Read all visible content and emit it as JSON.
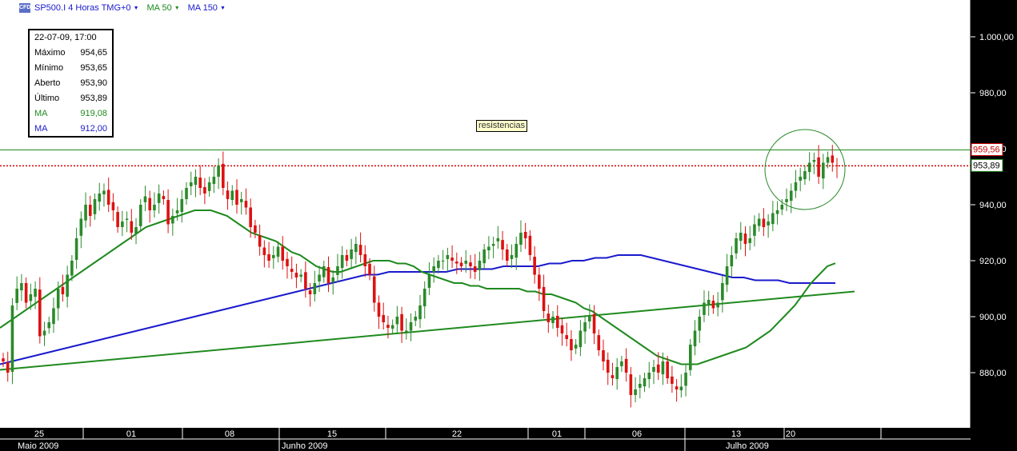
{
  "header": {
    "badge": "CFD",
    "instrument": "SP500.I 4 Horas TMG+0",
    "ma50": "MA 50",
    "ma150": "MA 150"
  },
  "colors": {
    "up": "#2a8a2a",
    "down": "#dd1111",
    "ma50": "#1f8a1f",
    "ma150": "#1a1acc",
    "trend": "#1f8a1f",
    "resistance_line": "#1f8a1f",
    "last_price_line": "#cc0000"
  },
  "info_box": {
    "datetime": "22-07-09, 17:00",
    "rows": [
      {
        "label": "Máximo",
        "value": "954,65"
      },
      {
        "label": "Mínimo",
        "value": "953,65"
      },
      {
        "label": "Aberto",
        "value": "953,90"
      },
      {
        "label": "Último",
        "value": "953,89"
      },
      {
        "label": "MA",
        "value": "919,08"
      },
      {
        "label": "MA",
        "value": "912,00"
      }
    ]
  },
  "annotation": "resistencias",
  "chart_data": {
    "type": "candlestick",
    "ylim": [
      863,
      1012
    ],
    "y_ticks": [
      "1.000,00",
      "980,00",
      "960,00",
      "940,00",
      "920,00",
      "900,00",
      "880,00"
    ],
    "y_tick_values": [
      1000,
      980,
      960,
      940,
      920,
      900,
      880
    ],
    "x_day_labels": [
      "25",
      "01",
      "08",
      "15",
      "22",
      "01",
      "06",
      "13",
      "20"
    ],
    "x_month_labels": [
      "Maio 2009",
      "Junho 2009",
      "Julho 2009"
    ],
    "resistance_level": "959,56",
    "resistance_value": 959.56,
    "last_price": "953,89",
    "last_value": 953.89,
    "trendline": {
      "from": 881,
      "to": 909
    },
    "closes": [
      884,
      880,
      904,
      910,
      912,
      905,
      908,
      910,
      893,
      895,
      898,
      903,
      910,
      908,
      915,
      920,
      928,
      935,
      940,
      936,
      942,
      944,
      945,
      940,
      938,
      932,
      934,
      935,
      930,
      932,
      940,
      943,
      938,
      940,
      944,
      942,
      933,
      936,
      938,
      942,
      946,
      948,
      950,
      946,
      944,
      948,
      950,
      954,
      946,
      942,
      945,
      940,
      942,
      939,
      932,
      930,
      925,
      922,
      920,
      922,
      925,
      920,
      918,
      916,
      914,
      915,
      910,
      908,
      912,
      915,
      918,
      912,
      914,
      918,
      922,
      920,
      924,
      926,
      922,
      918,
      915,
      905,
      900,
      898,
      896,
      897,
      900,
      895,
      895,
      898,
      900,
      904,
      910,
      915,
      918,
      920,
      920,
      922,
      920,
      919,
      918,
      920,
      918,
      916,
      920,
      924,
      925,
      926,
      928,
      924,
      920,
      922,
      926,
      930,
      928,
      922,
      915,
      910,
      902,
      898,
      900,
      896,
      894,
      892,
      888,
      890,
      895,
      898,
      900,
      894,
      888,
      884,
      880,
      878,
      882,
      884,
      880,
      872,
      874,
      876,
      878,
      880,
      882,
      880,
      884,
      878,
      876,
      874,
      875,
      880,
      890,
      895,
      900,
      905,
      906,
      903,
      905,
      912,
      918,
      922,
      928,
      930,
      926,
      928,
      933,
      935,
      932,
      934,
      937,
      938,
      940,
      942,
      945,
      948,
      950,
      952,
      955,
      956,
      950,
      955,
      957,
      955,
      953.89
    ],
    "ma50": [
      896,
      898,
      900,
      902,
      904,
      906,
      908,
      910,
      912,
      914,
      916,
      918,
      920,
      922,
      924,
      926,
      928,
      930,
      932,
      933,
      934,
      935,
      936,
      937,
      938,
      938,
      938,
      937,
      936,
      934,
      932,
      930,
      929,
      928,
      927,
      925,
      923,
      922,
      920,
      918,
      917,
      916,
      916,
      917,
      918,
      919,
      920,
      920,
      920,
      919,
      919,
      918,
      916,
      915,
      914,
      913,
      912,
      912,
      911,
      911,
      910,
      910,
      910,
      910,
      910,
      909,
      909,
      908,
      908,
      907,
      906,
      905,
      903,
      902,
      900,
      898,
      896,
      894,
      892,
      890,
      888,
      886,
      885,
      884,
      883,
      883,
      883,
      884,
      885,
      886,
      887,
      888,
      889,
      891,
      893,
      895,
      898,
      901,
      904,
      908,
      912,
      915,
      918,
      919.08
    ],
    "ma150": [
      883,
      884,
      885,
      886,
      887,
      888,
      889,
      890,
      891,
      892,
      893,
      894,
      895,
      896,
      897,
      898,
      899,
      900,
      901,
      902,
      903,
      904,
      905,
      906,
      907,
      908,
      909,
      910,
      911,
      912,
      913,
      914,
      915,
      915,
      916,
      916,
      916,
      916,
      916,
      916,
      917,
      917,
      917,
      917,
      918,
      918,
      918,
      918,
      919,
      919,
      920,
      920,
      921,
      921,
      922,
      922,
      922,
      921,
      920,
      919,
      918,
      917,
      916,
      915,
      914,
      914,
      913,
      913,
      913,
      912,
      912,
      912,
      912,
      912.0
    ]
  }
}
